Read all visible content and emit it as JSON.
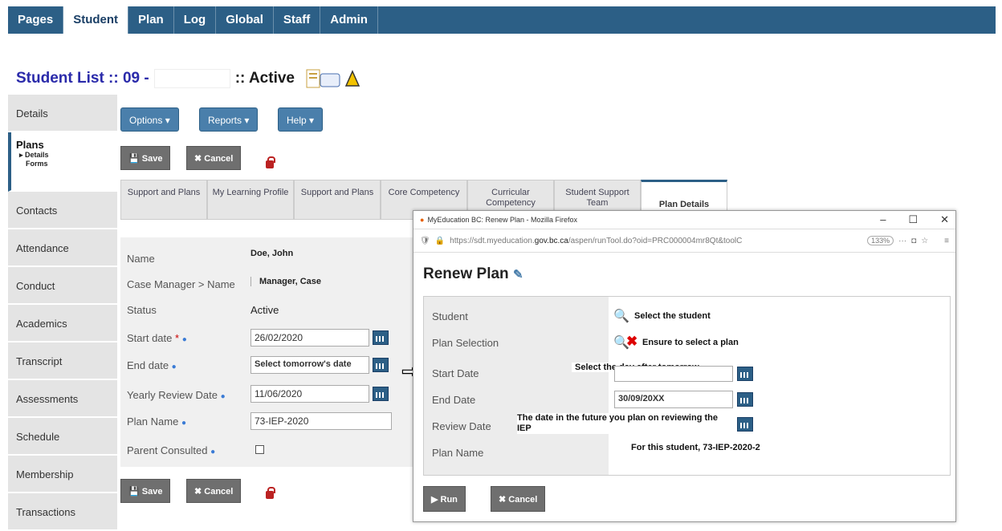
{
  "nav": {
    "tabs": [
      "Pages",
      "Student",
      "Plan",
      "Log",
      "Global",
      "Staff",
      "Admin"
    ]
  },
  "header": {
    "title": "Student List :: 09 - ",
    "status": ":: Active"
  },
  "sidebar": {
    "items": [
      "Details",
      "Plans",
      "Contacts",
      "Attendance",
      "Conduct",
      "Academics",
      "Transcript",
      "Assessments",
      "Schedule",
      "Membership",
      "Transactions"
    ],
    "sub": [
      "▸ Details",
      "Forms"
    ]
  },
  "toolbar": {
    "options": "Options ▾",
    "reports": "Reports ▾",
    "help": "Help ▾",
    "save": "Save",
    "cancel": "Cancel"
  },
  "subtabs": [
    "Support and Plans",
    "My Learning Profile",
    "Support and Plans",
    "Core Competency",
    "Curricular Competency",
    "Student Support Team",
    "Plan Details"
  ],
  "form": {
    "labels": {
      "name": "Name",
      "case": "Case Manager > Name",
      "status": "Status",
      "start": "Start date",
      "end": "End date",
      "yearly": "Yearly Review Date",
      "plan": "Plan Name",
      "parent": "Parent Consulted"
    },
    "values": {
      "name": "Doe, John",
      "case": "Manager, Case",
      "status": "Active",
      "start": "26/02/2020",
      "end": "Select tomorrow's date",
      "yearly": "11/06/2020",
      "plan": "73-IEP-2020"
    }
  },
  "popup": {
    "window_title": "MyEducation BC: Renew Plan - Mozilla Firefox",
    "url_pre": "https://sdt.myeducation.",
    "url_domain": "gov.bc.ca",
    "url_post": "/aspen/runTool.do?oid=PRC000004mr8Qt&toolC",
    "zoom": "133%",
    "heading": "Renew Plan",
    "labels": {
      "student": "Student",
      "selection": "Plan Selection",
      "start": "Start Date",
      "end": "End Date",
      "review": "Review Date",
      "name": "Plan Name"
    },
    "notes": {
      "student": "Select the student",
      "selection": "Ensure to select a plan",
      "start": "Select the day after tomorrow",
      "end": "30/09/20XX",
      "review": "The date in the future you plan on reviewing the IEP",
      "name": "For this student, 73-IEP-2020-2"
    },
    "run": "Run",
    "cancel": "Cancel"
  }
}
